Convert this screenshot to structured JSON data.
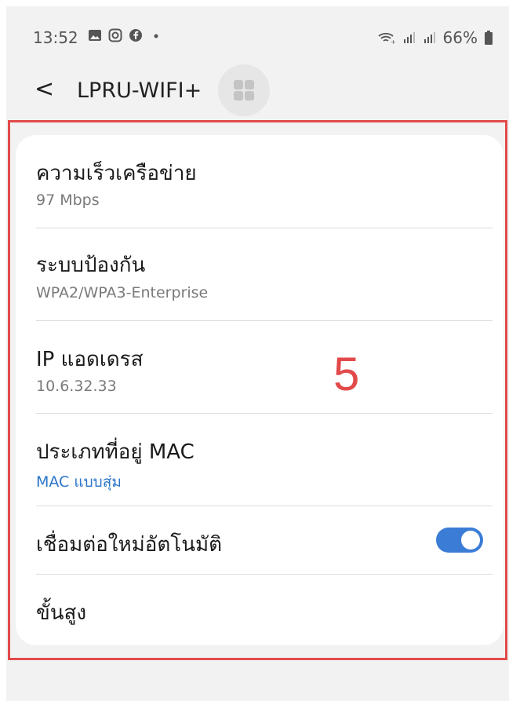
{
  "status_bar": {
    "time": "13:52",
    "battery": "66%",
    "left_icons": [
      "image-icon",
      "instagram-icon",
      "facebook-icon",
      "dot-icon"
    ],
    "right_icons": [
      "wifi-icon",
      "signal-icon",
      "signal-icon",
      "battery-icon"
    ]
  },
  "header": {
    "back_glyph": "<",
    "title": "LPRU-WIFI+"
  },
  "annotation": {
    "label": "5",
    "color": "#e24a4a"
  },
  "settings": {
    "network_speed": {
      "title": "ความเร็วเครือข่าย",
      "value": "97 Mbps"
    },
    "security": {
      "title": "ระบบป้องกัน",
      "value": "WPA2/WPA3-Enterprise"
    },
    "ip_address": {
      "title": "IP แอดเดรส",
      "value": "10.6.32.33"
    },
    "mac_type": {
      "title": "ประเภทที่อยู่ MAC",
      "value": "MAC แบบสุ่ม"
    },
    "auto_reconnect": {
      "title": "เชื่อมต่อใหม่อัตโนมัติ",
      "enabled": true
    },
    "advanced": {
      "title": "ขั้นสูง"
    }
  },
  "colors": {
    "accent": "#3a7cd6",
    "link": "#2a74c8"
  }
}
